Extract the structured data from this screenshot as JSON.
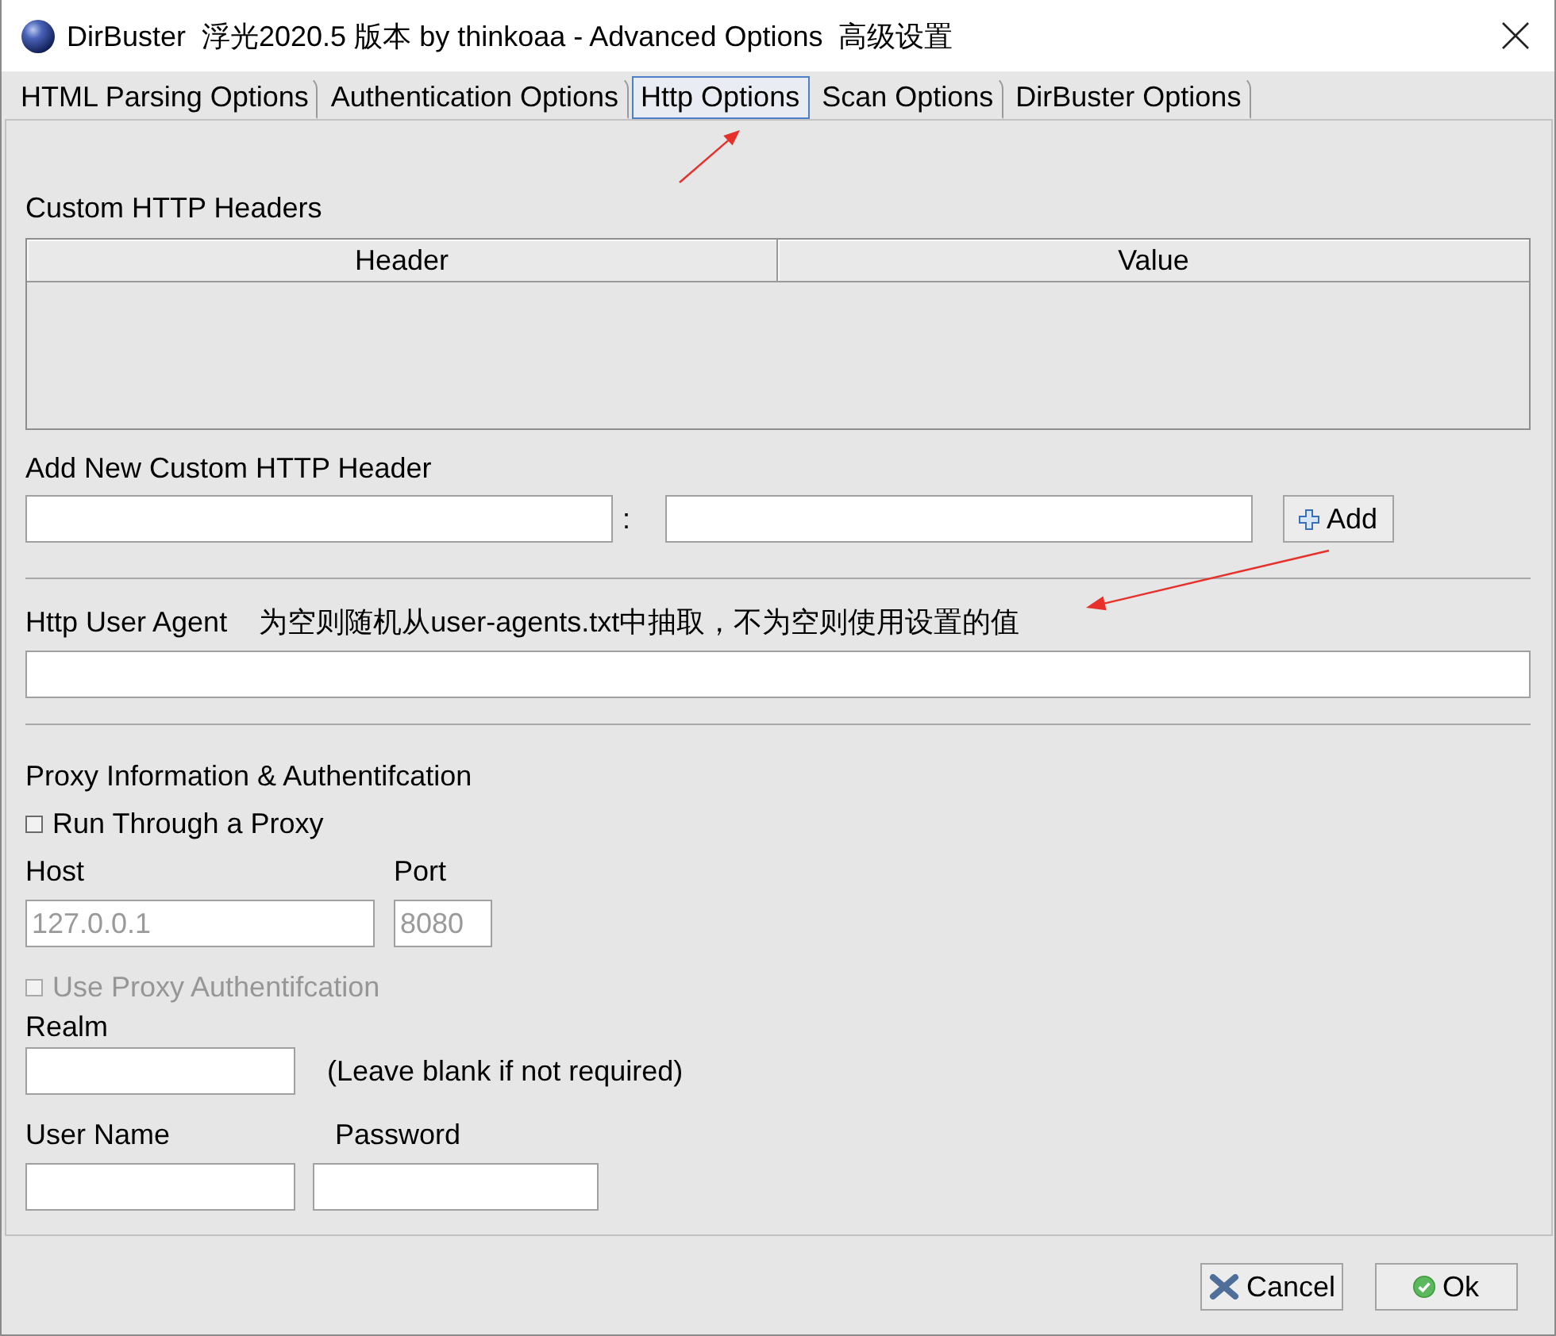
{
  "window": {
    "title": "DirBuster  浮光2020.5 版本 by thinkoaa - Advanced Options  高级设置"
  },
  "tabs": [
    {
      "label": "HTML Parsing Options",
      "selected": false
    },
    {
      "label": "Authentication Options",
      "selected": false
    },
    {
      "label": "Http Options",
      "selected": true
    },
    {
      "label": "Scan Options",
      "selected": false
    },
    {
      "label": "DirBuster Options",
      "selected": false
    }
  ],
  "custom_headers": {
    "title": "Custom HTTP Headers",
    "columns": [
      "Header",
      "Value"
    ]
  },
  "add_header": {
    "title": "Add New Custom HTTP Header",
    "separator": ":",
    "button": "Add"
  },
  "user_agent": {
    "label": "Http User Agent",
    "note": "为空则随机从user-agents.txt中抽取，不为空则使用设置的值"
  },
  "proxy": {
    "title": "Proxy Information & Authentifcation",
    "run_through": {
      "label": "Run Through a Proxy",
      "checked": false
    },
    "host": {
      "label": "Host",
      "value": "127.0.0.1",
      "disabled": true
    },
    "port": {
      "label": "Port",
      "value": "8080",
      "disabled": true
    },
    "use_auth": {
      "label": "Use Proxy Authentifcation",
      "checked": false,
      "disabled": true
    },
    "realm": {
      "label": "Realm",
      "note": "(Leave blank if not required)"
    },
    "user_name": {
      "label": "User Name"
    },
    "password": {
      "label": "Password"
    }
  },
  "buttons": [
    {
      "label": "Cancel",
      "kind": "cancel"
    },
    {
      "label": "Ok",
      "kind": "ok"
    }
  ]
}
